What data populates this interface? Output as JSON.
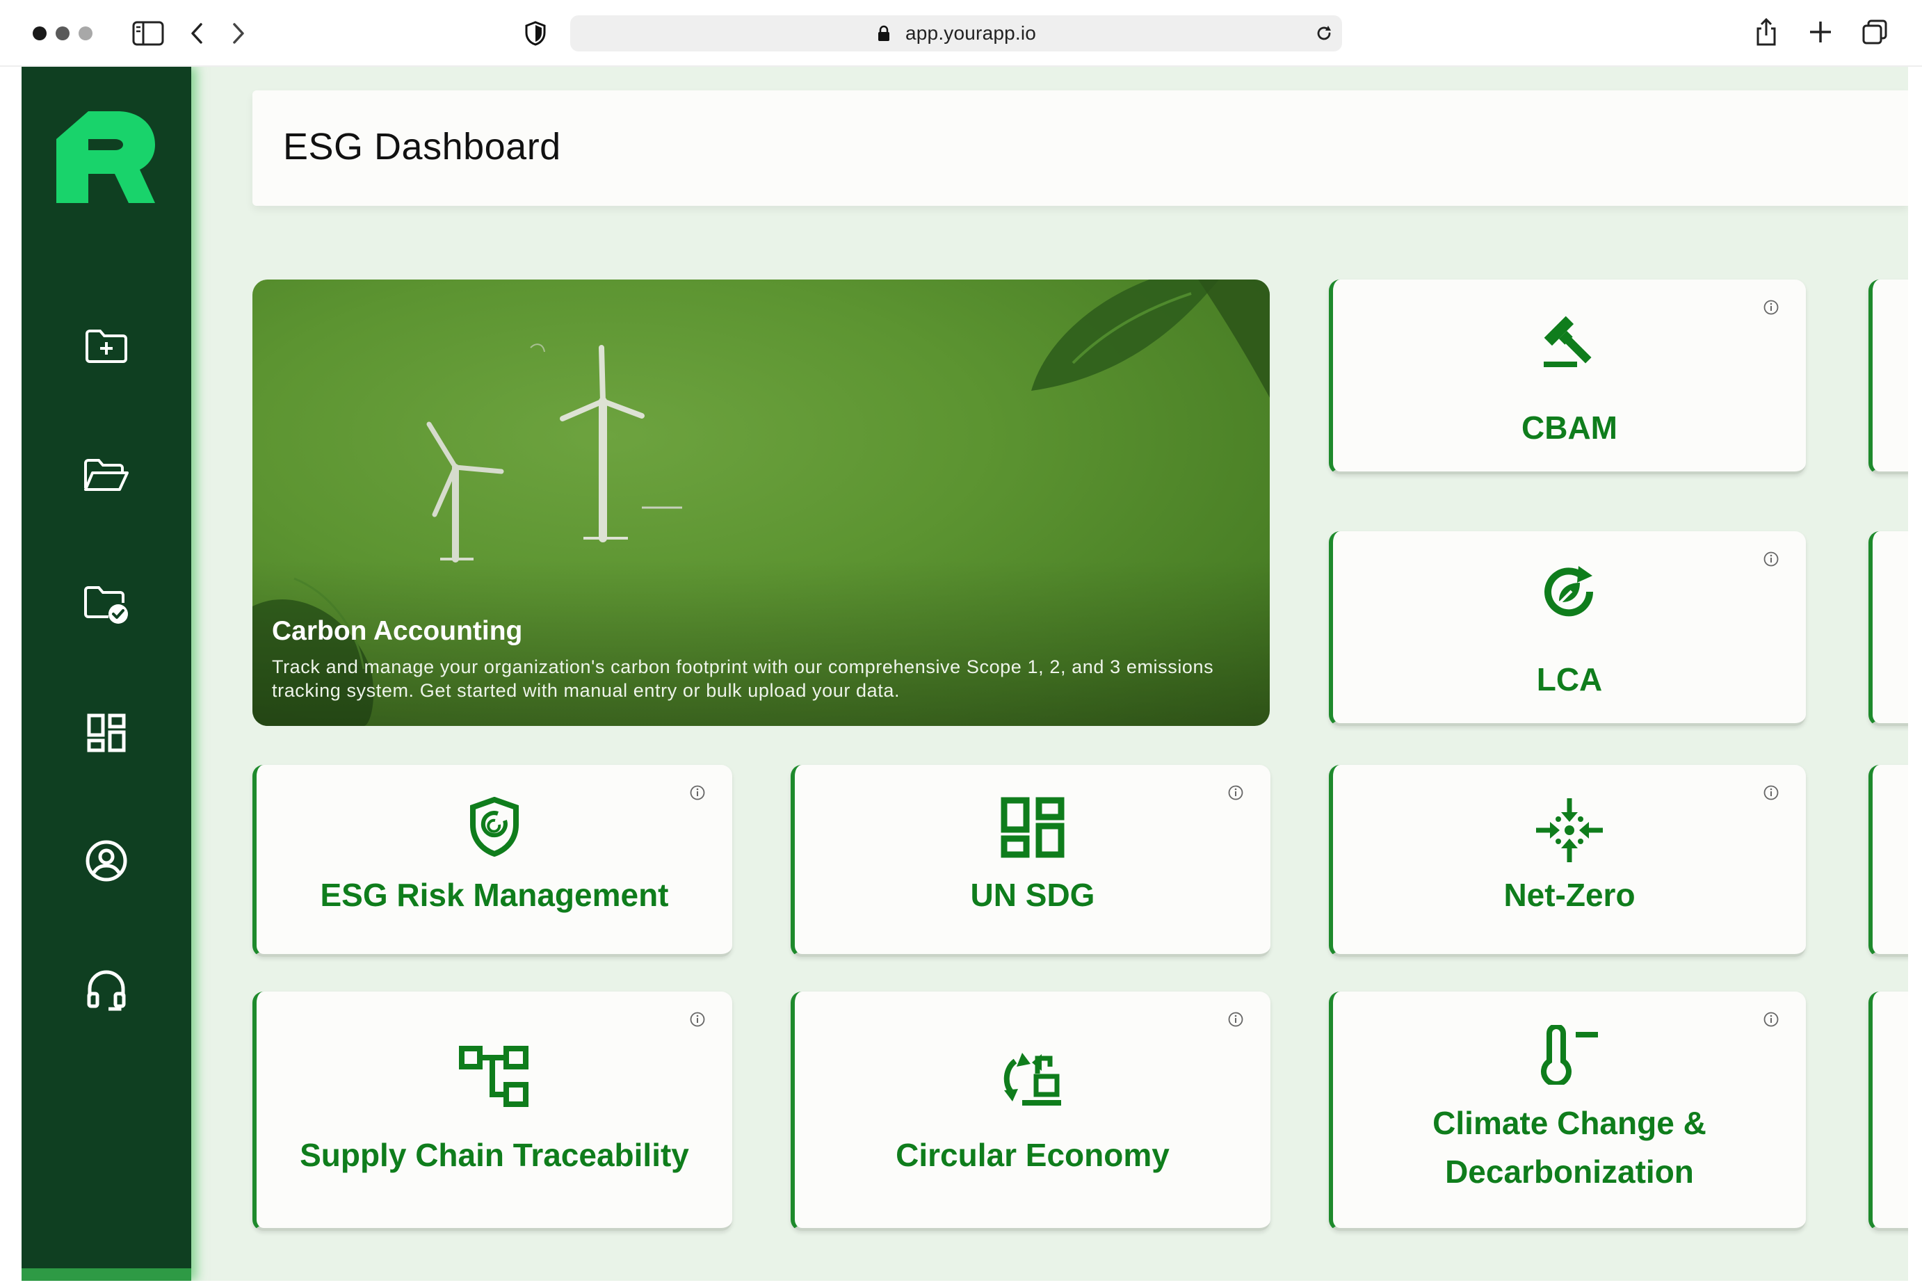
{
  "browser": {
    "url": "app.yourapp.io"
  },
  "sidebar": {
    "items": [
      {
        "icon": "folder-plus-icon"
      },
      {
        "icon": "folder-open-icon"
      },
      {
        "icon": "folder-check-icon"
      },
      {
        "icon": "dashboard-icon"
      },
      {
        "icon": "account-circle-icon"
      },
      {
        "icon": "headset-icon"
      }
    ]
  },
  "header": {
    "title": "ESG Dashboard"
  },
  "hero": {
    "title": "Carbon Accounting",
    "description": "Track and manage your organization's carbon footprint with our comprehensive Scope 1, 2, and 3 emissions tracking system. Get started with manual entry or bulk upload your data."
  },
  "cards": {
    "cbam": {
      "label": "CBAM",
      "icon": "gavel-icon"
    },
    "lca": {
      "label": "LCA",
      "icon": "eco-cycle-icon"
    },
    "esg_risk": {
      "label": "ESG Risk Management",
      "icon": "shield-icon"
    },
    "un_sdg": {
      "label": "UN SDG",
      "icon": "grid-dashboard-icon"
    },
    "net_zero": {
      "label": "Net-Zero",
      "icon": "converge-arrows-icon"
    },
    "supply_chain": {
      "label": "Supply Chain Traceability",
      "icon": "flow-tree-icon"
    },
    "circular": {
      "label": "Circular Economy",
      "icon": "recycle-loop-icon"
    },
    "climate": {
      "label_line1": "Climate Change &",
      "label_line2": "Decarbonization",
      "icon": "thermometer-minus-icon"
    }
  },
  "colors": {
    "sidebar": "#0f3f21",
    "accent_green": "#0f7d1c",
    "background": "#e9f3e8",
    "logo_green": "#19d36b"
  }
}
